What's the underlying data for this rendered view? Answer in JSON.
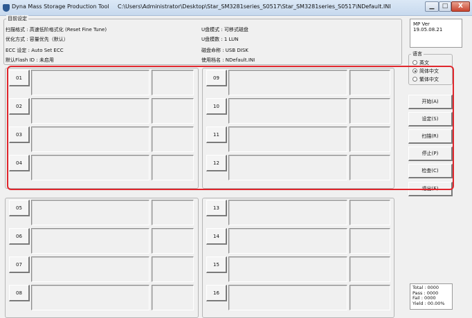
{
  "window": {
    "title": "Dyna Mass Storage Production Tool",
    "path": "C:\\Users\\Administrator\\Desktop\\Star_SM3281series_S0517\\Star_SM3281series_S0517\\NDefault.INI",
    "minimize_glyph": "▁",
    "maximize_glyph": "□",
    "close_glyph": "X"
  },
  "settings_group": {
    "legend": "目前设定",
    "left_lines": [
      "扫描格式 : 高速低阶格式化 (Reset Fine Tune)",
      "优化方式 : 容量优先（默认）",
      "ECC 设定 : Auto Set ECC",
      "默认Flash ID : 未启用"
    ],
    "right_lines": [
      "U盘模式 : 可移式磁盘",
      "U盘模数 : 1 LUN",
      "磁盘命称 : USB DISK",
      "使用档名 : NDefault.INI"
    ]
  },
  "slots": {
    "left_top": [
      "01",
      "02",
      "03",
      "04"
    ],
    "left_bottom": [
      "05",
      "06",
      "07",
      "08"
    ],
    "right_top": [
      "09",
      "10",
      "11",
      "12"
    ],
    "right_bottom": [
      "13",
      "14",
      "15",
      "16"
    ]
  },
  "side_panel": {
    "version": "MP Ver 19.05.08.21",
    "language_legend": "语言",
    "languages": [
      {
        "label": "英文",
        "selected": false
      },
      {
        "label": "简体中文",
        "selected": true
      },
      {
        "label": "繁体中文",
        "selected": false
      }
    ],
    "buttons": {
      "start": "开始(A)",
      "settings": "设定(S)",
      "scan": "扫描(R)",
      "stop": "停止(P)",
      "check": "检查(C)",
      "exit": "退出(E)"
    },
    "stats": {
      "total": "Total : 0000",
      "pass": "Pass : 0000",
      "fail": "Fail : 0000",
      "yield": "Yield : 00.00%"
    }
  },
  "colors": {
    "highlight": "#e0262c",
    "titlebar": "#c7d9ee",
    "window_bg": "#f0f0f0"
  }
}
